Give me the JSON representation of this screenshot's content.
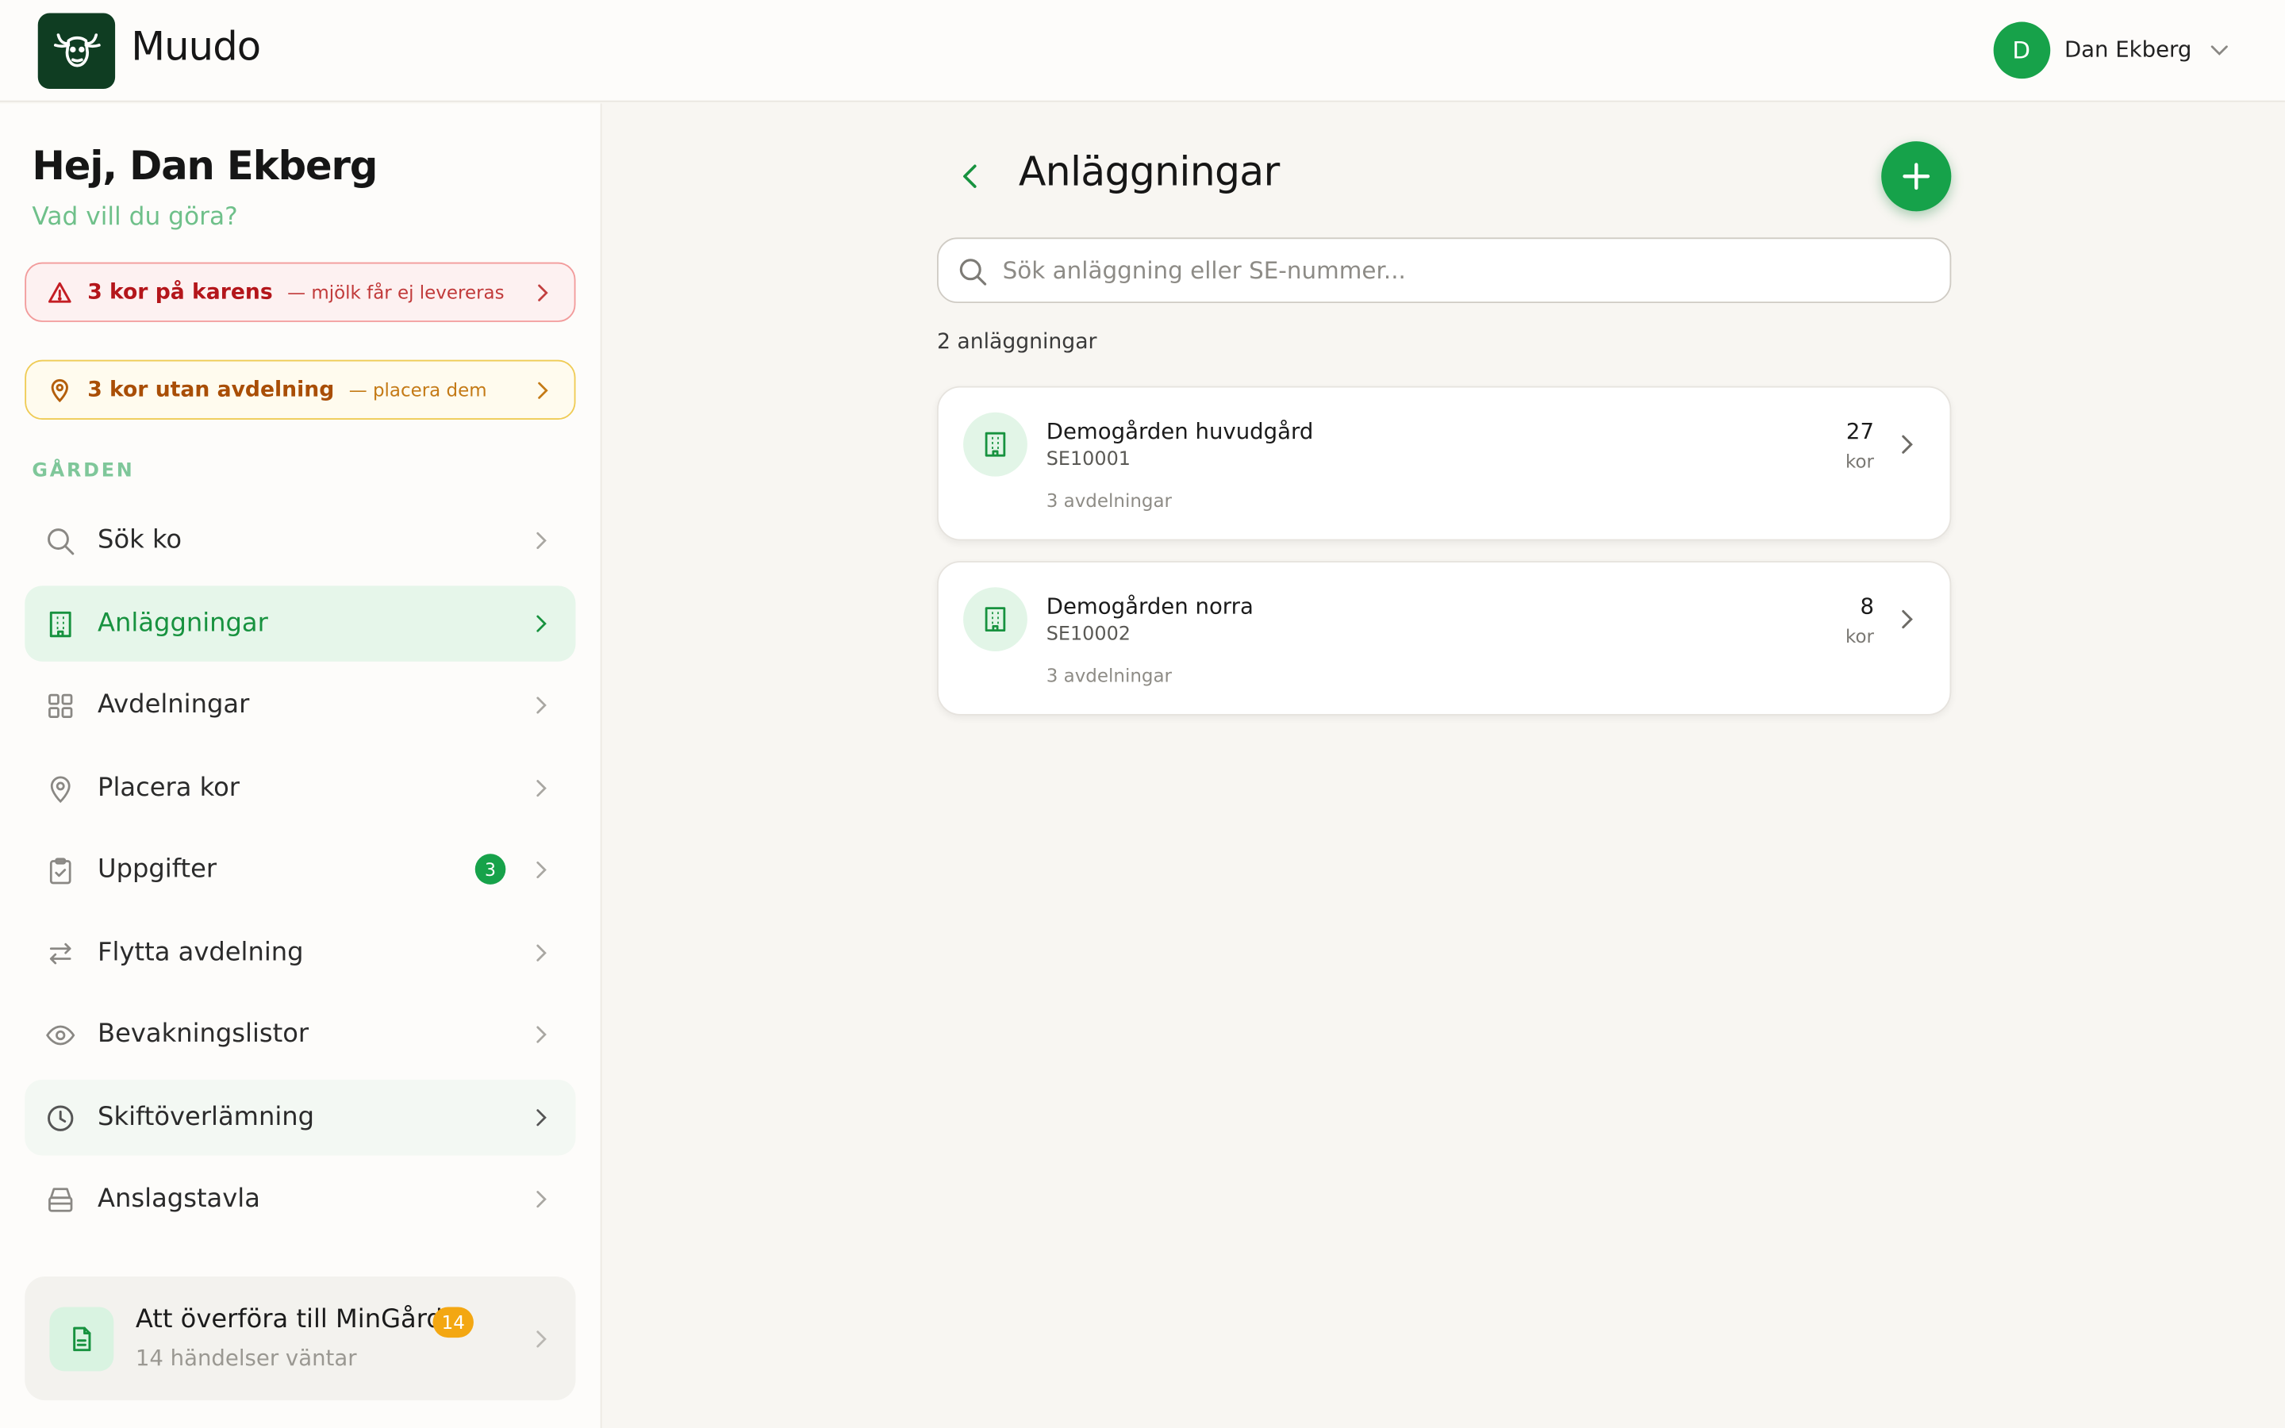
{
  "app": {
    "brand": "Muudo"
  },
  "user": {
    "initial": "D",
    "name": "Dan Ekberg"
  },
  "sidebar": {
    "greeting": "Hej, Dan Ekberg",
    "sub_greeting": "Vad vill du göra?",
    "alerts": [
      {
        "main": "3 kor på karens",
        "sub": "— mjölk får ej levereras",
        "icon": "warning-triangle-icon",
        "color": "#b4161b"
      },
      {
        "main": "3 kor utan avdelning",
        "sub": "— placera dem",
        "icon": "map-pin-icon",
        "color": "#a94e06"
      }
    ],
    "section_label": "GÅRDEN",
    "items": [
      {
        "label": "Sök ko",
        "icon": "search-icon"
      },
      {
        "label": "Anläggningar",
        "icon": "building-icon",
        "active": true
      },
      {
        "label": "Avdelningar",
        "icon": "grid-icon"
      },
      {
        "label": "Placera kor",
        "icon": "map-pin-icon"
      },
      {
        "label": "Uppgifter",
        "icon": "clipboard-check-icon",
        "badge": "3"
      },
      {
        "label": "Flytta avdelning",
        "icon": "swap-arrows-icon"
      },
      {
        "label": "Bevakningslistor",
        "icon": "eye-icon"
      },
      {
        "label": "Skiftöverlämning",
        "icon": "clock-icon"
      },
      {
        "label": "Anslagstavla",
        "icon": "inbox-icon"
      }
    ],
    "transfer": {
      "title": "Att överföra till MinGård",
      "badge": "14",
      "sub": "14 händelser väntar"
    }
  },
  "main": {
    "title": "Anläggningar",
    "search_placeholder": "Sök anläggning eller SE-nummer...",
    "count_label": "2 anläggningar",
    "facilities": [
      {
        "name": "Demogården huvudgård",
        "se": "SE10001",
        "departments": "3 avdelningar",
        "cows": "27",
        "unit": "kor"
      },
      {
        "name": "Demogården norra",
        "se": "SE10002",
        "departments": "3 avdelningar",
        "cows": "8",
        "unit": "kor"
      }
    ]
  },
  "colors": {
    "accent": "#16a24a",
    "accent_dark": "#0f3d22",
    "alert_red": "#b4161b",
    "alert_amber": "#a94e06",
    "badge_orange": "#f3a712"
  }
}
